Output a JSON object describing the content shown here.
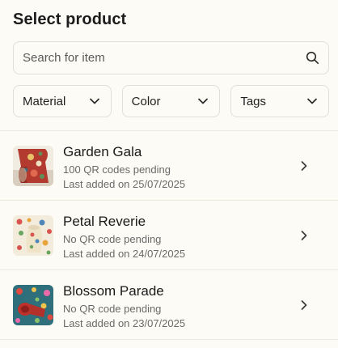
{
  "header": {
    "title": "Select product"
  },
  "search": {
    "placeholder": "Search for item",
    "value": "",
    "icon": "search-icon"
  },
  "filters": [
    {
      "label": "Material",
      "icon": "chevron-down-icon"
    },
    {
      "label": "Color",
      "icon": "chevron-down-icon"
    },
    {
      "label": "Tags",
      "icon": "chevron-down-icon"
    }
  ],
  "products": [
    {
      "name": "Garden Gala",
      "status": "100 QR codes pending",
      "last_added": "Last added on 25/07/2025",
      "thumbnail": "fabric-roll-red-floral"
    },
    {
      "name": "Petal Reverie",
      "status": "No QR code pending",
      "last_added": "Last added on 24/07/2025",
      "thumbnail": "fabric-roll-cream-floral"
    },
    {
      "name": "Blossom Parade",
      "status": "No QR code pending",
      "last_added": "Last added on 23/07/2025",
      "thumbnail": "fabric-roll-teal-floral"
    }
  ],
  "colors": {
    "background": "#fdfbf5",
    "border": "#e2dfd6",
    "text_primary": "#1c1c1c",
    "text_secondary": "#6a6a6a"
  }
}
